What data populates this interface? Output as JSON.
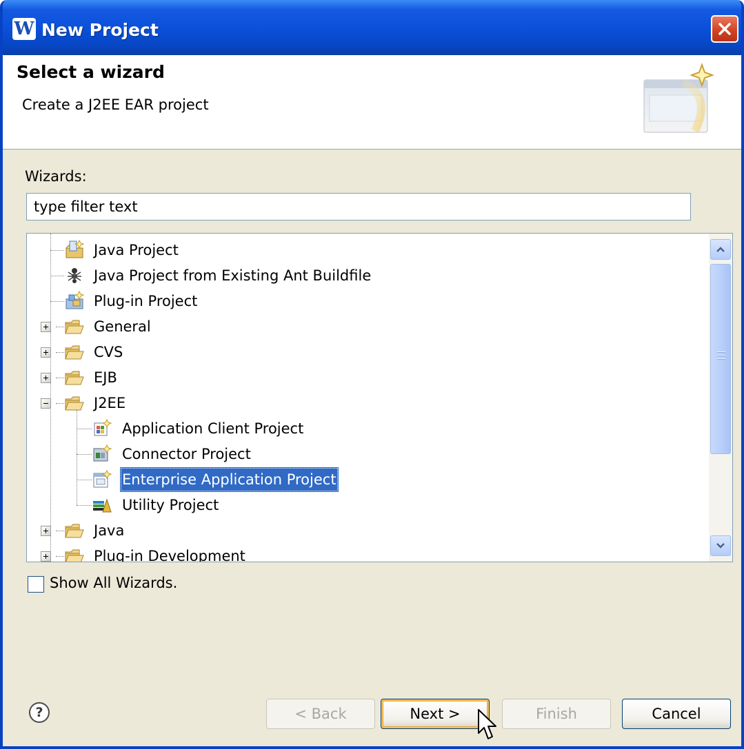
{
  "window": {
    "title": "New Project",
    "app_icon_letter": "W"
  },
  "header": {
    "title": "Select a wizard",
    "description": "Create a J2EE EAR project"
  },
  "wizards": {
    "label": "Wizards:",
    "filter_value": "type filter text",
    "tree": [
      {
        "label": "Java Project",
        "icon": "java-project-icon"
      },
      {
        "label": "Java Project from Existing Ant Buildfile",
        "icon": "ant-icon"
      },
      {
        "label": "Plug-in Project",
        "icon": "plugin-project-icon"
      },
      {
        "label": "General",
        "icon": "folder-icon",
        "expander": "+"
      },
      {
        "label": "CVS",
        "icon": "folder-icon",
        "expander": "+"
      },
      {
        "label": "EJB",
        "icon": "folder-icon",
        "expander": "+"
      },
      {
        "label": "J2EE",
        "icon": "folder-icon",
        "expander": "-"
      },
      {
        "label": "Application Client Project",
        "icon": "app-client-project-icon"
      },
      {
        "label": "Connector Project",
        "icon": "connector-project-icon"
      },
      {
        "label": "Enterprise Application Project",
        "icon": "enterprise-app-project-icon",
        "selected": true
      },
      {
        "label": "Utility Project",
        "icon": "utility-project-icon"
      },
      {
        "label": "Java",
        "icon": "folder-icon",
        "expander": "+"
      },
      {
        "label": "Plug-in Development",
        "icon": "folder-icon",
        "expander": "+"
      }
    ]
  },
  "show_all": {
    "label": "Show All Wizards.",
    "checked": false
  },
  "buttons": {
    "help": "?",
    "back": "< Back",
    "next": "Next >",
    "finish": "Finish",
    "cancel": "Cancel"
  },
  "colors": {
    "titlebar": "#0a4fd8",
    "selection": "#316ac5",
    "dialog_bg": "#ece9d8"
  }
}
